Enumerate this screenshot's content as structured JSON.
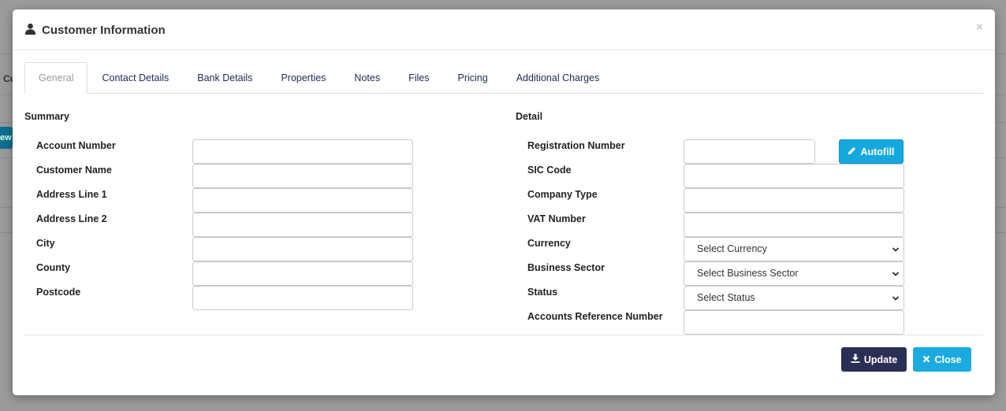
{
  "background": {
    "partial_heading": "Cu",
    "partial_button": "ew"
  },
  "modal": {
    "title": "Customer Information",
    "close_glyph": "×",
    "tabs": [
      {
        "label": "General",
        "active": true
      },
      {
        "label": "Contact Details",
        "active": false
      },
      {
        "label": "Bank Details",
        "active": false
      },
      {
        "label": "Properties",
        "active": false
      },
      {
        "label": "Notes",
        "active": false
      },
      {
        "label": "Files",
        "active": false
      },
      {
        "label": "Pricing",
        "active": false
      },
      {
        "label": "Additional Charges",
        "active": false
      }
    ],
    "summary": {
      "title": "Summary",
      "fields": [
        {
          "label": "Account Number",
          "value": ""
        },
        {
          "label": "Customer Name",
          "value": ""
        },
        {
          "label": "Address Line 1",
          "value": ""
        },
        {
          "label": "Address Line 2",
          "value": ""
        },
        {
          "label": "City",
          "value": ""
        },
        {
          "label": "County",
          "value": ""
        },
        {
          "label": "Postcode",
          "value": ""
        }
      ]
    },
    "detail": {
      "title": "Detail",
      "registration_label": "Registration Number",
      "registration_value": "",
      "autofill_label": "Autofill",
      "sic_label": "SIC Code",
      "company_type_label": "Company Type",
      "vat_label": "VAT Number",
      "currency_label": "Currency",
      "currency_selected": "Select Currency",
      "sector_label": "Business Sector",
      "sector_selected": "Select Business Sector",
      "status_label": "Status",
      "status_selected": "Select Status",
      "accounts_ref_label": "Accounts Reference Number"
    },
    "footer": {
      "update_label": "Update",
      "close_label": "Close"
    }
  },
  "colors": {
    "primary_dark": "#2a2f55",
    "info": "#1aaae0",
    "tab_text": "#1f2a52"
  }
}
